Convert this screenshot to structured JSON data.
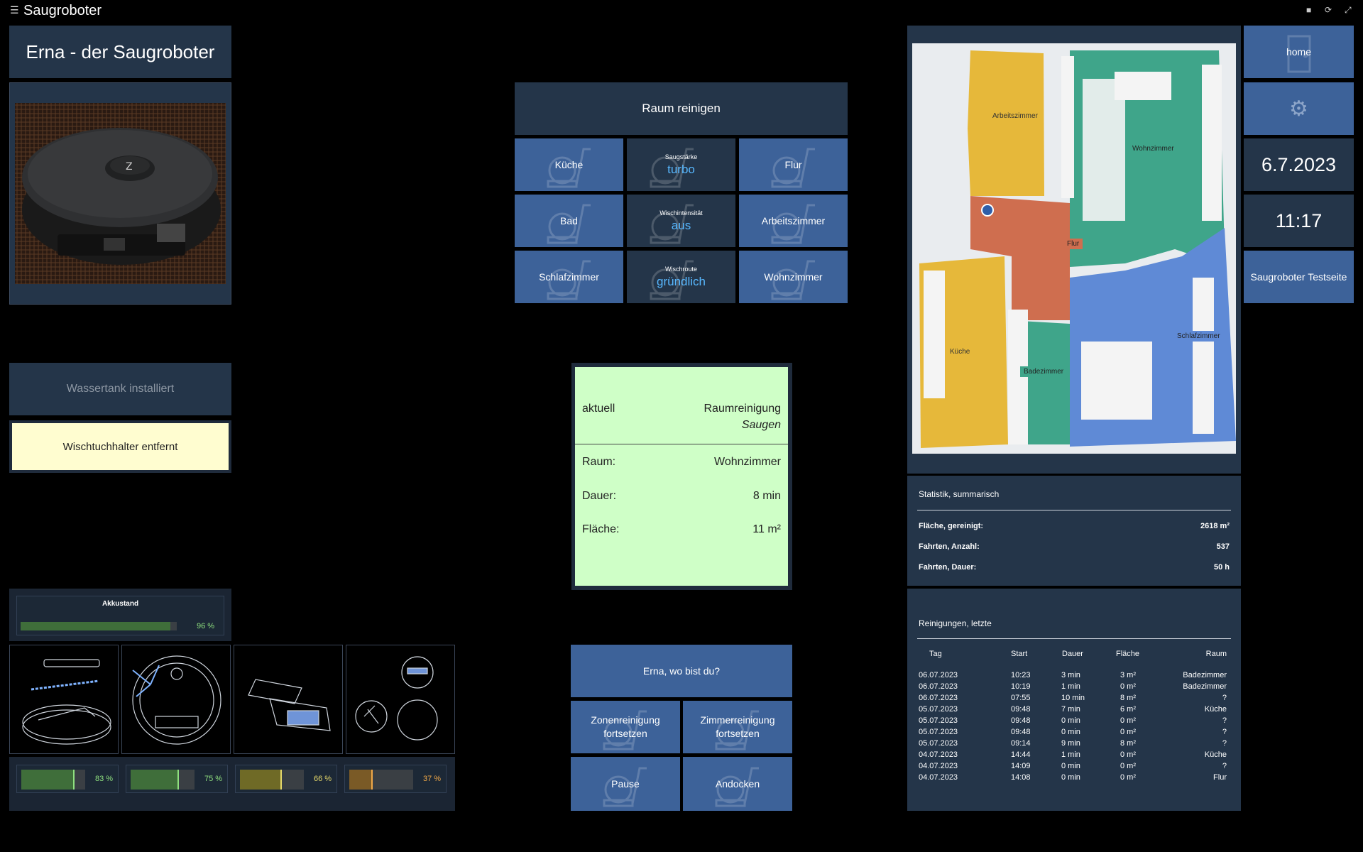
{
  "header": {
    "title": "Saugroboter"
  },
  "left": {
    "title": "Erna - der Saugroboter",
    "water_tank": "Wassertank installiert",
    "mop_holder": "Wischtuchhalter entfernt",
    "battery": {
      "label": "Akkustand",
      "value": 96,
      "text": "96 %"
    },
    "consumables": [
      {
        "value": 83,
        "text": "83 %",
        "color": "#3f6e3a",
        "text_color": "#8fe07f"
      },
      {
        "value": 75,
        "text": "75 %",
        "color": "#3f6e3a",
        "text_color": "#8fe07f"
      },
      {
        "value": 66,
        "text": "66 %",
        "color": "#6f6a26",
        "text_color": "#e6d96a"
      },
      {
        "value": 37,
        "text": "37 %",
        "color": "#7a5a26",
        "text_color": "#f0a848"
      }
    ]
  },
  "rooms": {
    "title": "Raum reinigen",
    "kitchen": "Küche",
    "hall": "Flur",
    "bath": "Bad",
    "office": "Arbeitszimmer",
    "bedroom": "Schlafzimmer",
    "living": "Wohnzimmer",
    "suction": {
      "label": "Saugstärke",
      "value": "turbo"
    },
    "mop_intensity": {
      "label": "Wischintensität",
      "value": "aus"
    },
    "mop_route": {
      "label": "Wischroute",
      "value": "gründlich"
    }
  },
  "status": {
    "current_label": "aktuell",
    "mode": "Raumreinigung",
    "submode": "Saugen",
    "room_label": "Raum:",
    "room_value": "Wohnzimmer",
    "duration_label": "Dauer:",
    "duration_value": "8 min",
    "area_label": "Fläche:",
    "area_value": "11 m²"
  },
  "actions": {
    "where": "Erna, wo bist du?",
    "zone_continue": "Zonenreinigung fortsetzen",
    "room_continue": "Zimmerreinigung fortsetzen",
    "pause": "Pause",
    "dock": "Andocken"
  },
  "map": {
    "labels": {
      "office": "Arbeitszimmer",
      "living": "Wohnzimmer",
      "hall": "Flur",
      "bedroom": "Schlafzimmer",
      "kitchen": "Küche",
      "bath": "Badezimmer"
    }
  },
  "right": {
    "home": "home",
    "date": "6.7.2023",
    "time": "11:17",
    "testpage": "Saugroboter Testseite"
  },
  "stats": {
    "title": "Statistik, summarisch",
    "rows": [
      {
        "label": "Fläche, gereinigt:",
        "value": "2618 m²"
      },
      {
        "label": "Fahrten, Anzahl:",
        "value": "537"
      },
      {
        "label": "Fahrten, Dauer:",
        "value": "50 h"
      }
    ]
  },
  "history": {
    "title": "Reinigungen, letzte",
    "headers": [
      "Tag",
      "Start",
      "Dauer",
      "Fläche",
      "Raum"
    ],
    "rows": [
      [
        "06.07.2023",
        "10:23",
        "3 min",
        "3 m²",
        "Badezimmer"
      ],
      [
        "06.07.2023",
        "10:19",
        "1 min",
        "0 m²",
        "Badezimmer"
      ],
      [
        "06.07.2023",
        "07:55",
        "10 min",
        "8 m²",
        "?"
      ],
      [
        "05.07.2023",
        "09:48",
        "7 min",
        "6 m²",
        "Küche"
      ],
      [
        "05.07.2023",
        "09:48",
        "0 min",
        "0 m²",
        "?"
      ],
      [
        "05.07.2023",
        "09:48",
        "0 min",
        "0 m²",
        "?"
      ],
      [
        "05.07.2023",
        "09:14",
        "9 min",
        "8 m²",
        "?"
      ],
      [
        "04.07.2023",
        "14:44",
        "1 min",
        "0 m²",
        "Küche"
      ],
      [
        "04.07.2023",
        "14:09",
        "0 min",
        "0 m²",
        "?"
      ],
      [
        "04.07.2023",
        "14:08",
        "0 min",
        "0 m²",
        "Flur"
      ]
    ]
  }
}
